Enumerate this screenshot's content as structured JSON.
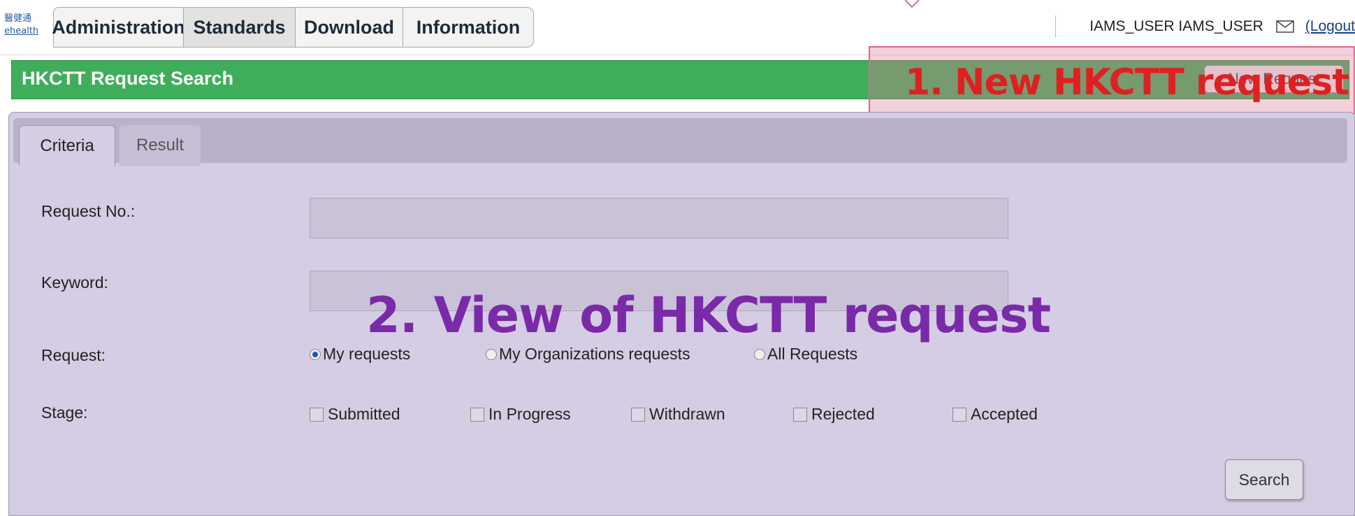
{
  "header": {
    "logo_line1": "醫健通",
    "logo_line2": "ehealth",
    "nav_tabs": [
      "Administration",
      "Standards",
      "Download",
      "Information"
    ],
    "user_name": "IAMS_USER IAMS_USER",
    "logout": "(Logout"
  },
  "page": {
    "title": "HKCTT Request Search",
    "new_request_button": "New Request"
  },
  "annotations": {
    "note1": "1. New HKCTT request",
    "note2": "2. View of HKCTT request"
  },
  "panel": {
    "tabs": [
      "Criteria",
      "Result"
    ],
    "fields": {
      "request_no": {
        "label": "Request No.:",
        "value": ""
      },
      "keyword": {
        "label": "Keyword:",
        "value": ""
      }
    },
    "request": {
      "label": "Request:",
      "options": [
        "My requests",
        "My Organizations requests",
        "All Requests"
      ],
      "selected": "My requests"
    },
    "stage": {
      "label": "Stage:",
      "options": [
        "Submitted",
        "In Progress",
        "Withdrawn",
        "Rejected",
        "Accepted"
      ]
    },
    "search_button": "Search"
  },
  "colors": {
    "title_bar": "#3fae5b",
    "panel_bg": "#d4cde3",
    "annotation_red": "#e02020",
    "annotation_purple": "#7a2aa8"
  }
}
